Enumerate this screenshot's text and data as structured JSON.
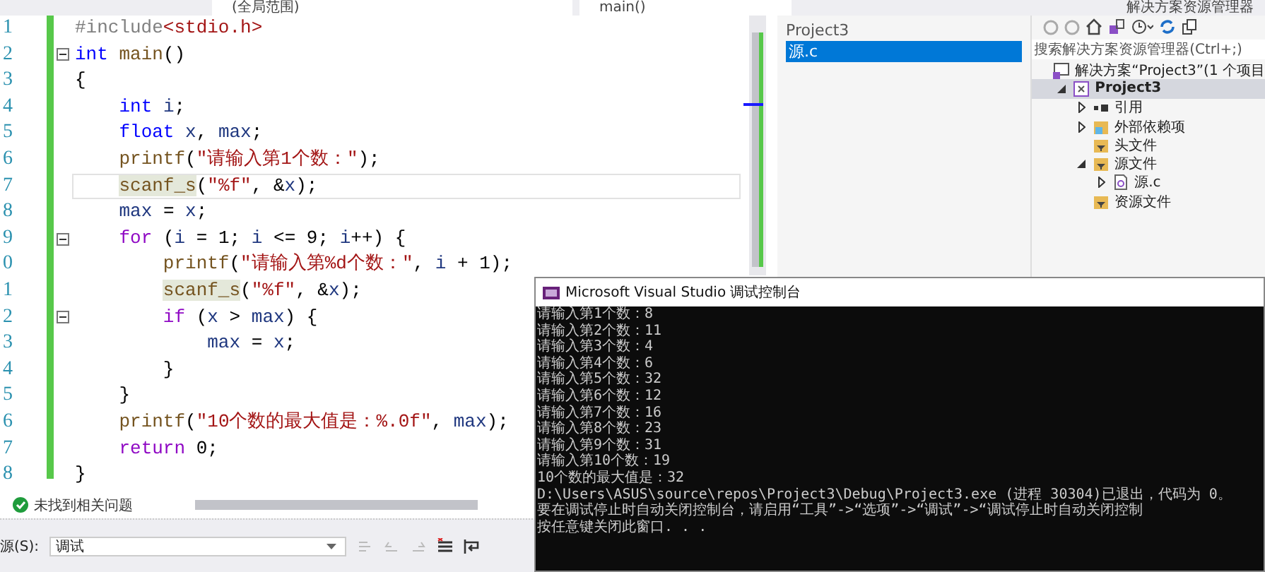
{
  "top_bar": {
    "scope_dropdown": "(全局范围)",
    "member_dropdown": "main()",
    "panel_title": "解决方案资源管理器"
  },
  "editor": {
    "lines": [
      {
        "number": "1",
        "fold": false,
        "current": false,
        "tokens": [
          {
            "text": "#include",
            "kind": "directive"
          },
          {
            "text": "<stdio.h>",
            "kind": "string"
          }
        ]
      },
      {
        "number": "2",
        "fold": true,
        "current": false,
        "tokens": [
          {
            "text": "int ",
            "kind": "keyword"
          },
          {
            "text": "main",
            "kind": "function"
          },
          {
            "text": "()",
            "kind": "plain"
          }
        ]
      },
      {
        "number": "3",
        "fold": false,
        "current": false,
        "tokens": [
          {
            "text": "{",
            "kind": "plain"
          }
        ]
      },
      {
        "number": "4",
        "fold": false,
        "current": false,
        "tokens": [
          {
            "text": "    int ",
            "kind": "keyword"
          },
          {
            "text": "i",
            "kind": "variable"
          },
          {
            "text": ";",
            "kind": "plain"
          }
        ]
      },
      {
        "number": "5",
        "fold": false,
        "current": false,
        "tokens": [
          {
            "text": "    float ",
            "kind": "keyword"
          },
          {
            "text": "x",
            "kind": "variable"
          },
          {
            "text": ", ",
            "kind": "plain"
          },
          {
            "text": "max",
            "kind": "variable"
          },
          {
            "text": ";",
            "kind": "plain"
          }
        ]
      },
      {
        "number": "6",
        "fold": false,
        "current": false,
        "tokens": [
          {
            "text": "    printf",
            "kind": "function"
          },
          {
            "text": "(",
            "kind": "plain"
          },
          {
            "text": "\"请输入第1个数：\"",
            "kind": "string"
          },
          {
            "text": ");",
            "kind": "plain"
          }
        ]
      },
      {
        "number": "7",
        "fold": false,
        "current": true,
        "tokens": [
          {
            "text": "    scanf_s",
            "kind": "function_marked"
          },
          {
            "text": "(",
            "kind": "plain"
          },
          {
            "text": "\"%f\"",
            "kind": "string"
          },
          {
            "text": ", &",
            "kind": "plain"
          },
          {
            "text": "x",
            "kind": "variable"
          },
          {
            "text": ");",
            "kind": "plain"
          }
        ]
      },
      {
        "number": "8",
        "fold": false,
        "current": false,
        "tokens": [
          {
            "text": "    max",
            "kind": "variable"
          },
          {
            "text": " = ",
            "kind": "plain"
          },
          {
            "text": "x",
            "kind": "variable"
          },
          {
            "text": ";",
            "kind": "plain"
          }
        ]
      },
      {
        "number": "9",
        "fold": true,
        "current": false,
        "tokens": [
          {
            "text": "    for",
            "kind": "control"
          },
          {
            "text": " (",
            "kind": "plain"
          },
          {
            "text": "i",
            "kind": "variable"
          },
          {
            "text": " = 1; ",
            "kind": "plain"
          },
          {
            "text": "i",
            "kind": "variable"
          },
          {
            "text": " <= 9; ",
            "kind": "plain"
          },
          {
            "text": "i",
            "kind": "variable"
          },
          {
            "text": "++) {",
            "kind": "plain"
          }
        ]
      },
      {
        "number": "0",
        "fold": false,
        "current": false,
        "tokens": [
          {
            "text": "        printf",
            "kind": "function"
          },
          {
            "text": "(",
            "kind": "plain"
          },
          {
            "text": "\"请输入第%d个数：\"",
            "kind": "string"
          },
          {
            "text": ", ",
            "kind": "plain"
          },
          {
            "text": "i",
            "kind": "variable"
          },
          {
            "text": " + 1);",
            "kind": "plain"
          }
        ]
      },
      {
        "number": "1",
        "fold": false,
        "current": false,
        "tokens": [
          {
            "text": "        scanf_s",
            "kind": "function_marked"
          },
          {
            "text": "(",
            "kind": "plain"
          },
          {
            "text": "\"%f\"",
            "kind": "string"
          },
          {
            "text": ", &",
            "kind": "plain"
          },
          {
            "text": "x",
            "kind": "variable"
          },
          {
            "text": ");",
            "kind": "plain"
          }
        ]
      },
      {
        "number": "2",
        "fold": true,
        "current": false,
        "tokens": [
          {
            "text": "        if",
            "kind": "control"
          },
          {
            "text": " (",
            "kind": "plain"
          },
          {
            "text": "x",
            "kind": "variable"
          },
          {
            "text": " > ",
            "kind": "plain"
          },
          {
            "text": "max",
            "kind": "variable"
          },
          {
            "text": ") {",
            "kind": "plain"
          }
        ]
      },
      {
        "number": "3",
        "fold": false,
        "current": false,
        "tokens": [
          {
            "text": "            max",
            "kind": "variable"
          },
          {
            "text": " = ",
            "kind": "plain"
          },
          {
            "text": "x",
            "kind": "variable"
          },
          {
            "text": ";",
            "kind": "plain"
          }
        ]
      },
      {
        "number": "4",
        "fold": false,
        "current": false,
        "tokens": [
          {
            "text": "        }",
            "kind": "plain"
          }
        ]
      },
      {
        "number": "5",
        "fold": false,
        "current": false,
        "tokens": [
          {
            "text": "    }",
            "kind": "plain"
          }
        ]
      },
      {
        "number": "6",
        "fold": false,
        "current": false,
        "tokens": [
          {
            "text": "    printf",
            "kind": "function"
          },
          {
            "text": "(",
            "kind": "plain"
          },
          {
            "text": "\"10个数的最大值是：%.0f\"",
            "kind": "string"
          },
          {
            "text": ", ",
            "kind": "plain"
          },
          {
            "text": "max",
            "kind": "variable"
          },
          {
            "text": ");",
            "kind": "plain"
          }
        ]
      },
      {
        "number": "7",
        "fold": false,
        "current": false,
        "tokens": [
          {
            "text": "    return",
            "kind": "control"
          },
          {
            "text": " 0;",
            "kind": "plain"
          }
        ]
      },
      {
        "number": "8",
        "fold": false,
        "current": false,
        "tokens": [
          {
            "text": "}",
            "kind": "plain"
          }
        ]
      }
    ]
  },
  "file_list": {
    "group": "Project3",
    "items": [
      {
        "label": "源.c",
        "selected": true
      }
    ]
  },
  "solution_explorer": {
    "search": {
      "placeholder": "搜索解决方案资源管理器(Ctrl+;)"
    },
    "tree": [
      {
        "label": "解决方案“Project3”(1 个项目",
        "kind": "solution",
        "selected": false,
        "children": [
          {
            "label": "Project3",
            "kind": "project",
            "selected": true,
            "expanded": true,
            "children": [
              {
                "label": "引用",
                "kind": "references",
                "selected": false,
                "expanded": false
              },
              {
                "label": "外部依赖项",
                "kind": "external",
                "selected": false,
                "expanded": false
              },
              {
                "label": "头文件",
                "kind": "filter",
                "selected": false
              },
              {
                "label": "源文件",
                "kind": "filter",
                "selected": false,
                "expanded": true,
                "children": [
                  {
                    "label": "源.c",
                    "kind": "file",
                    "selected": false,
                    "expanded": false
                  }
                ]
              },
              {
                "label": "资源文件",
                "kind": "filter",
                "selected": false
              }
            ]
          }
        ]
      }
    ]
  },
  "status_bar": {
    "message": "未找到相关问题"
  },
  "output_panel": {
    "source_label": "源(S):",
    "source_value": "调试"
  },
  "console": {
    "title": "Microsoft Visual Studio 调试控制台",
    "lines": [
      "请输入第1个数：8",
      "请输入第2个数：11",
      "请输入第3个数：4",
      "请输入第4个数：6",
      "请输入第5个数：32",
      "请输入第6个数：12",
      "请输入第7个数：16",
      "请输入第8个数：23",
      "请输入第9个数：31",
      "请输入第10个数：19",
      "10个数的最大值是：32",
      "D:\\Users\\ASUS\\source\\repos\\Project3\\Debug\\Project3.exe (进程 30304)已退出，代码为 0。",
      "要在调试停止时自动关闭控制台，请启用“工具”->“选项”->“调试”->“调试停止时自动关闭控制",
      "按任意键关闭此窗口. . ."
    ]
  }
}
